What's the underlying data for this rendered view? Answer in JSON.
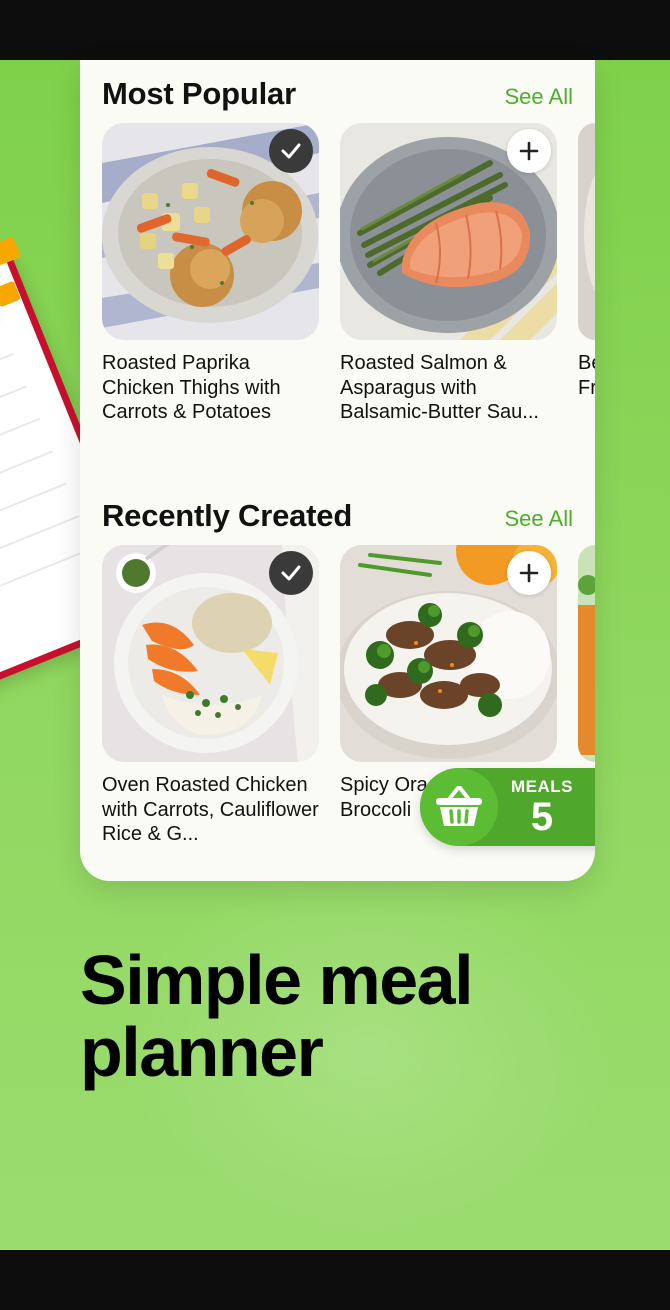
{
  "sections": {
    "popular": {
      "title": "Most Popular",
      "see_all": "See All",
      "items": [
        {
          "name": "Roasted Paprika Chicken Thighs with Carrots & Potatoes",
          "state": "selected",
          "icon": "check-icon"
        },
        {
          "name": "Roasted Salmon & Asparagus with Balsamic-Butter Sau...",
          "state": "add",
          "icon": "plus-icon"
        },
        {
          "name": "Be Fr"
        }
      ]
    },
    "recent": {
      "title": "Recently Created",
      "see_all": "See All",
      "items": [
        {
          "name": "Oven Roasted Chicken with Carrots, Cauliflower Rice & G...",
          "state": "selected",
          "icon": "check-icon"
        },
        {
          "name": "Spicy Ora Broccoli",
          "state": "add",
          "icon": "plus-icon"
        }
      ]
    }
  },
  "cart": {
    "label": "MEALS",
    "count": "5",
    "icon": "basket-icon"
  },
  "headline": {
    "line1": "Simple meal",
    "line2": "planner"
  },
  "colors": {
    "accent": "#4caf2a",
    "background_green": "#8fd75e",
    "card": "#fbfbf5",
    "clipboard": "#c8102e"
  }
}
